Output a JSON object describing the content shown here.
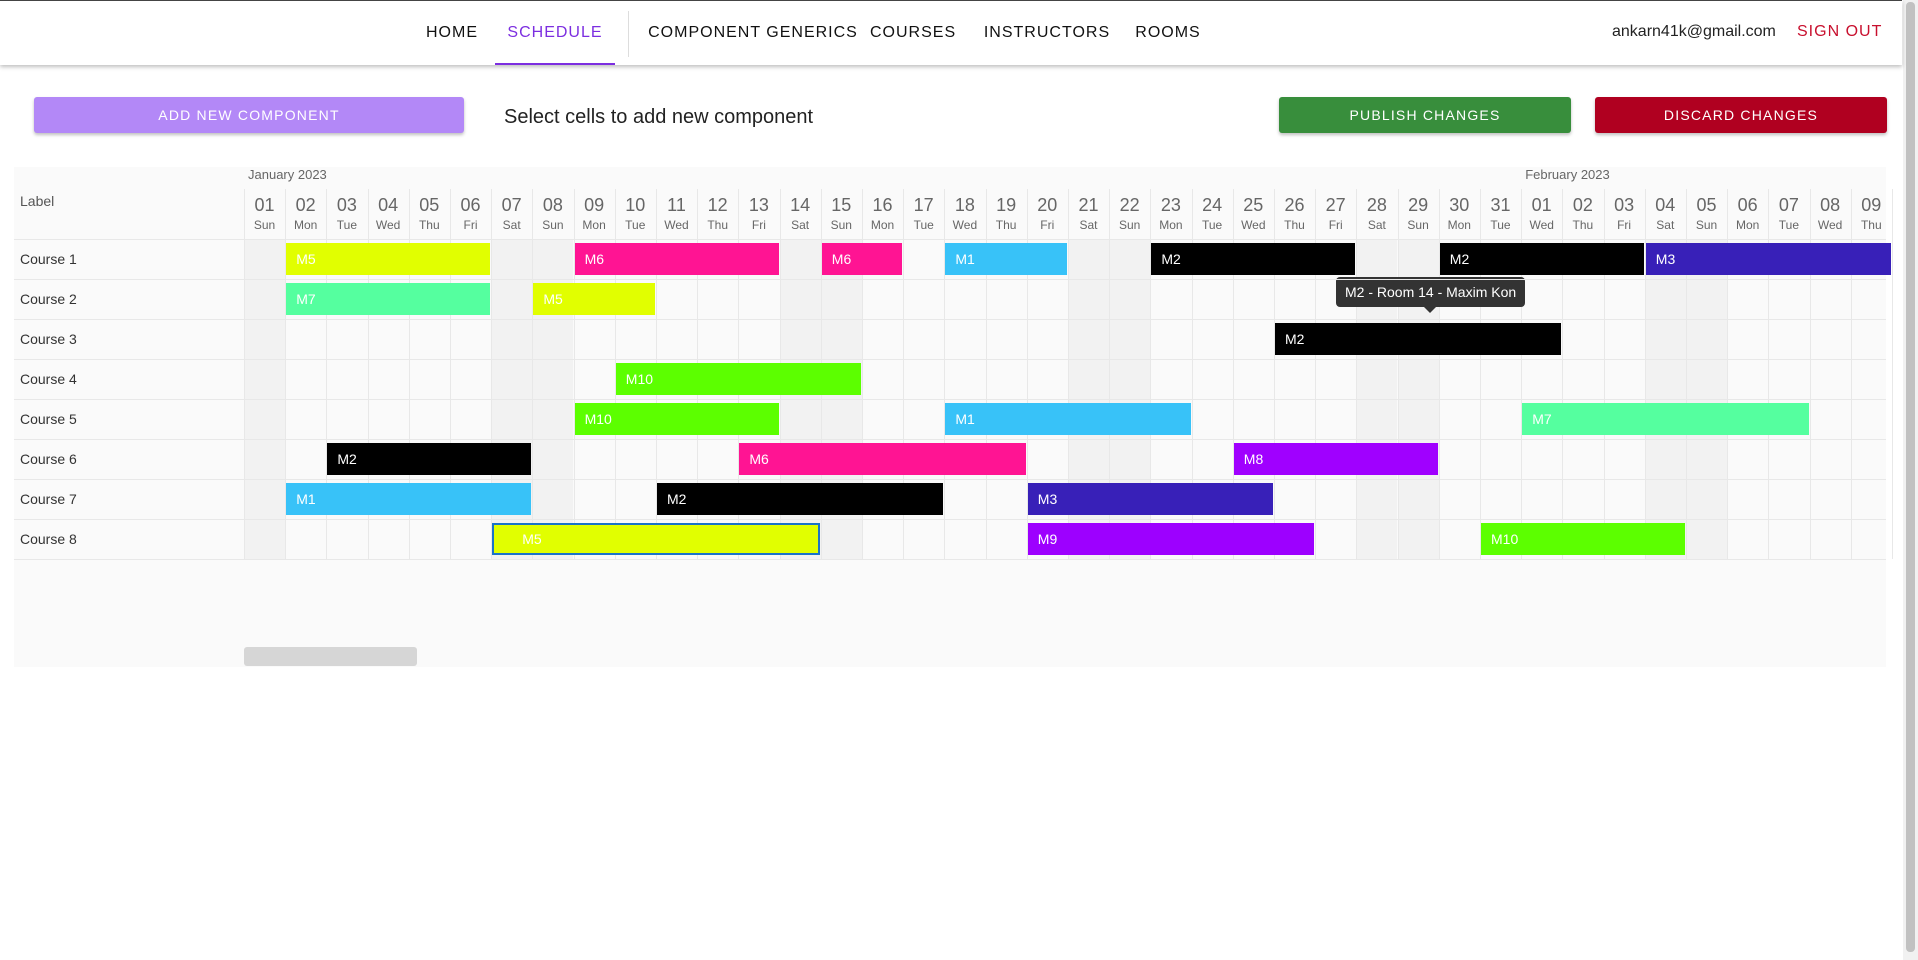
{
  "nav": {
    "items": [
      {
        "label": "HOME",
        "active": false
      },
      {
        "label": "SCHEDULE",
        "active": true
      },
      {
        "label": "COMPONENT GENERICS",
        "active": false
      },
      {
        "label": "COURSES",
        "active": false
      },
      {
        "label": "INSTRUCTORS",
        "active": false
      },
      {
        "label": "ROOMS",
        "active": false
      }
    ],
    "user_email": "ankarn41k@gmail.com",
    "sign_out": "SIGN OUT"
  },
  "toolbar": {
    "add_label": "ADD NEW COMPONENT",
    "hint": "Select cells to add new component",
    "publish_label": "PUBLISH CHANGES",
    "discard_label": "DISCARD CHANGES",
    "add_color": "#b388f7",
    "publish_color": "#388e3c",
    "discard_color": "#b00020"
  },
  "timeline": {
    "label_header": "Label",
    "months": [
      "January 2023",
      "February 2023"
    ],
    "days": [
      {
        "num": "01",
        "name": "Sun"
      },
      {
        "num": "02",
        "name": "Mon"
      },
      {
        "num": "03",
        "name": "Tue"
      },
      {
        "num": "04",
        "name": "Wed"
      },
      {
        "num": "05",
        "name": "Thu"
      },
      {
        "num": "06",
        "name": "Fri"
      },
      {
        "num": "07",
        "name": "Sat"
      },
      {
        "num": "08",
        "name": "Sun"
      },
      {
        "num": "09",
        "name": "Mon"
      },
      {
        "num": "10",
        "name": "Tue"
      },
      {
        "num": "11",
        "name": "Wed"
      },
      {
        "num": "12",
        "name": "Thu"
      },
      {
        "num": "13",
        "name": "Fri"
      },
      {
        "num": "14",
        "name": "Sat"
      },
      {
        "num": "15",
        "name": "Sun"
      },
      {
        "num": "16",
        "name": "Mon"
      },
      {
        "num": "17",
        "name": "Tue"
      },
      {
        "num": "18",
        "name": "Wed"
      },
      {
        "num": "19",
        "name": "Thu"
      },
      {
        "num": "20",
        "name": "Fri"
      },
      {
        "num": "21",
        "name": "Sat"
      },
      {
        "num": "22",
        "name": "Sun"
      },
      {
        "num": "23",
        "name": "Mon"
      },
      {
        "num": "24",
        "name": "Tue"
      },
      {
        "num": "25",
        "name": "Wed"
      },
      {
        "num": "26",
        "name": "Thu"
      },
      {
        "num": "27",
        "name": "Fri"
      },
      {
        "num": "28",
        "name": "Sat"
      },
      {
        "num": "29",
        "name": "Sun"
      },
      {
        "num": "30",
        "name": "Mon"
      },
      {
        "num": "31",
        "name": "Tue"
      },
      {
        "num": "01",
        "name": "Wed"
      },
      {
        "num": "02",
        "name": "Thu"
      },
      {
        "num": "03",
        "name": "Fri"
      },
      {
        "num": "04",
        "name": "Sat"
      },
      {
        "num": "05",
        "name": "Sun"
      },
      {
        "num": "06",
        "name": "Mon"
      },
      {
        "num": "07",
        "name": "Tue"
      },
      {
        "num": "08",
        "name": "Wed"
      },
      {
        "num": "09",
        "name": "Thu"
      }
    ],
    "rows": [
      "Course 1",
      "Course 2",
      "Course 3",
      "Course 4",
      "Course 5",
      "Course 6",
      "Course 7",
      "Course 8"
    ],
    "bars": [
      {
        "row": 0,
        "start": 1,
        "end": 6,
        "label": "M5",
        "color": "#e1ff00"
      },
      {
        "row": 0,
        "start": 8,
        "end": 13,
        "label": "M6",
        "color": "#ff1493"
      },
      {
        "row": 0,
        "start": 14,
        "end": 16,
        "label": "M6",
        "color": "#ff1493"
      },
      {
        "row": 0,
        "start": 17,
        "end": 20,
        "label": "M1",
        "color": "#38c2f8"
      },
      {
        "row": 0,
        "start": 22,
        "end": 27,
        "label": "M2",
        "color": "#000000"
      },
      {
        "row": 0,
        "start": 29,
        "end": 34,
        "label": "M2",
        "color": "#000000"
      },
      {
        "row": 0,
        "start": 34,
        "end": 40,
        "label": "M3",
        "color": "#3820b8"
      },
      {
        "row": 1,
        "start": 1,
        "end": 6,
        "label": "M7",
        "color": "#55ff9f"
      },
      {
        "row": 1,
        "start": 7,
        "end": 10,
        "label": "M5",
        "color": "#e1ff00"
      },
      {
        "row": 2,
        "start": 25,
        "end": 32,
        "label": "M2",
        "color": "#000000"
      },
      {
        "row": 3,
        "start": 9,
        "end": 15,
        "label": "M10",
        "color": "#5cff00"
      },
      {
        "row": 4,
        "start": 8,
        "end": 13,
        "label": "M10",
        "color": "#5cff00"
      },
      {
        "row": 4,
        "start": 17,
        "end": 23,
        "label": "M1",
        "color": "#38c2f8"
      },
      {
        "row": 4,
        "start": 31,
        "end": 38,
        "label": "M7",
        "color": "#55ff9f"
      },
      {
        "row": 5,
        "start": 2,
        "end": 7,
        "label": "M2",
        "color": "#000000"
      },
      {
        "row": 5,
        "start": 12,
        "end": 19,
        "label": "M6",
        "color": "#ff1493"
      },
      {
        "row": 5,
        "start": 24,
        "end": 29,
        "label": "M8",
        "color": "#a000ff"
      },
      {
        "row": 6,
        "start": 1,
        "end": 7,
        "label": "M1",
        "color": "#38c2f8"
      },
      {
        "row": 6,
        "start": 10,
        "end": 17,
        "label": "M2",
        "color": "#000000"
      },
      {
        "row": 6,
        "start": 19,
        "end": 25,
        "label": "M3",
        "color": "#3820b8"
      },
      {
        "row": 7,
        "start": 6,
        "end": 14,
        "label": "M5",
        "color": "#e1ff00",
        "selected": true
      },
      {
        "row": 7,
        "start": 19,
        "end": 26,
        "label": "M9",
        "color": "#9d00ff"
      },
      {
        "row": 7,
        "start": 30,
        "end": 35,
        "label": "M10",
        "color": "#5cff00"
      }
    ],
    "tooltip": "M2 - Room 14 - Maxim Kon"
  }
}
